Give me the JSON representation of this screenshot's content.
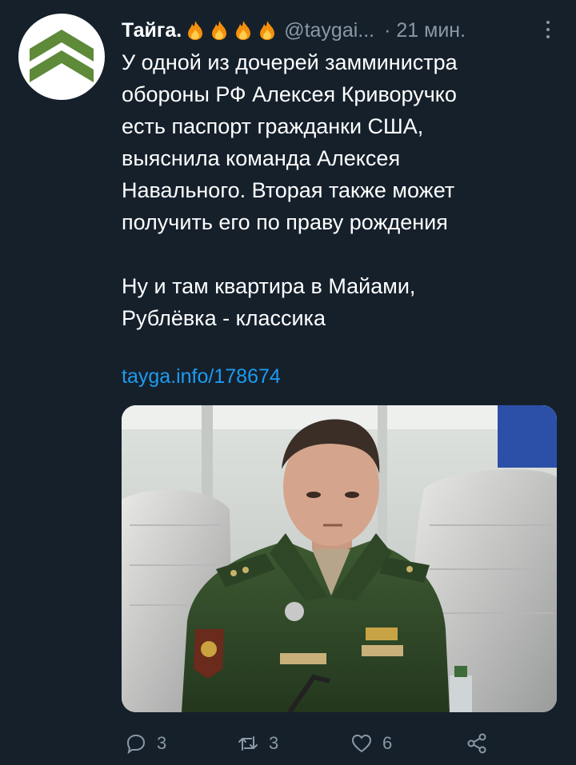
{
  "tweet": {
    "author_name": "Тайга.",
    "handle": "@taygai...",
    "time": "· 21 мин.",
    "text_lines": [
      "У одной из дочерей замминистра",
      "обороны РФ Алексея Криворучко",
      "есть паспорт гражданки США,",
      "выяснила команда Алексея",
      "Навального. Вторая также может",
      "получить его по праву рождения"
    ],
    "text_lines_2": [
      "Ну и там квартира в Майами,",
      "Рублёвка - классика"
    ],
    "link": "tayga.info/178674"
  },
  "actions": {
    "replies": "3",
    "retweets": "3",
    "likes": "6"
  },
  "icons": {
    "avatar": "tayga-logo-chevrons",
    "name_emoji": "fire-emoji",
    "more": "more-vertical-icon",
    "reply": "reply-icon",
    "retweet": "retweet-icon",
    "like": "heart-icon",
    "share": "share-icon"
  },
  "colors": {
    "background": "#15202b",
    "text": "#ffffff",
    "secondary": "#8b98a5",
    "link": "#1d9bf0",
    "logo_green": "#5e8a3a"
  }
}
